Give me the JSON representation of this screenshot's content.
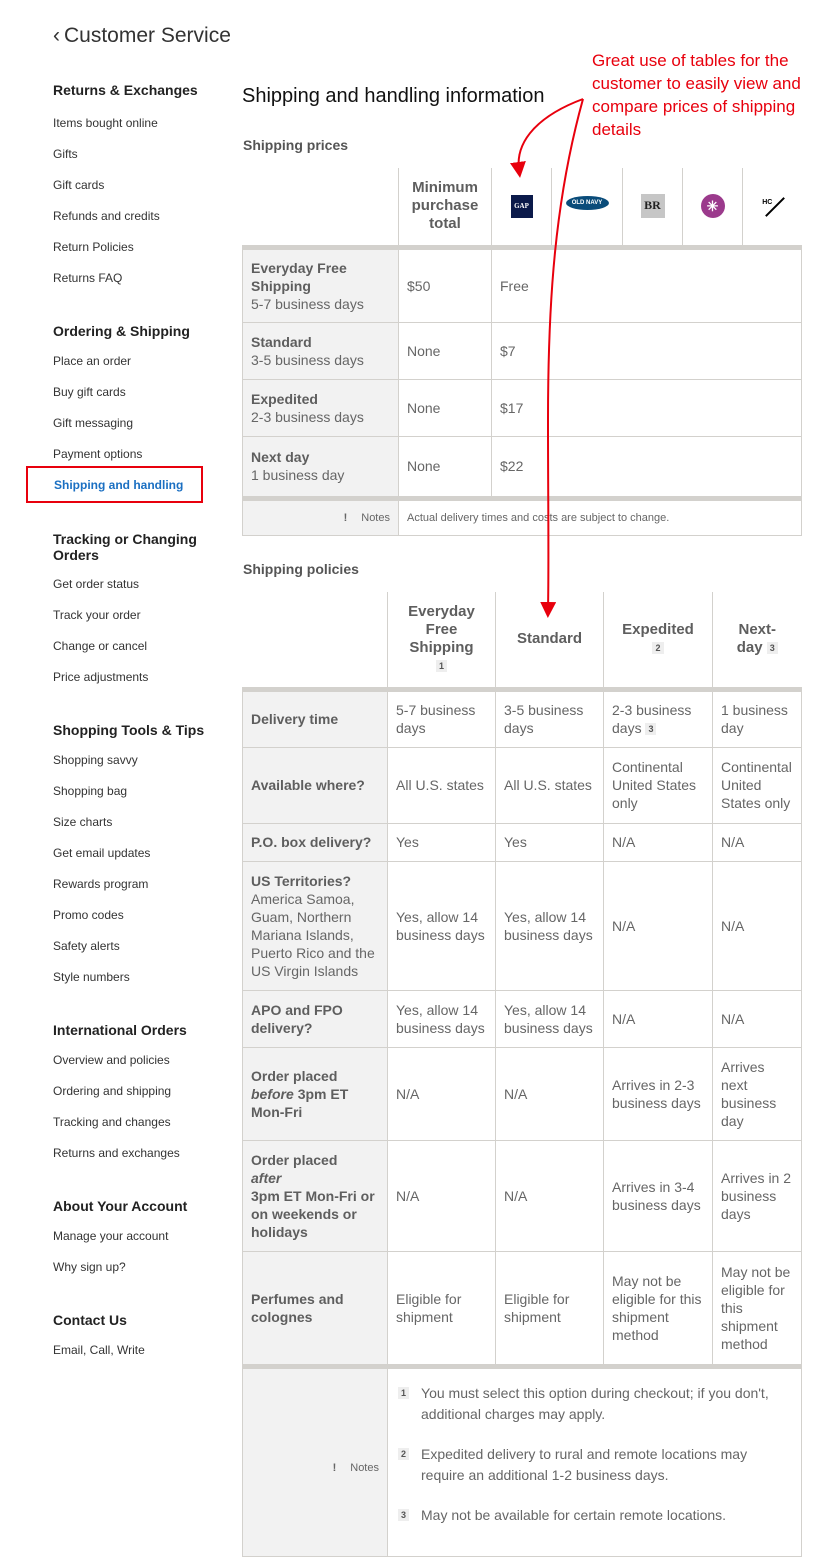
{
  "header": {
    "back_chevron": "‹",
    "back_label": "Customer Service"
  },
  "sidebar": {
    "groups": [
      {
        "heading": "Returns & Exchanges",
        "items": [
          "Items bought online",
          "Gifts",
          "Gift cards",
          "Refunds and credits",
          "Return Policies",
          "Returns FAQ"
        ]
      },
      {
        "heading": "Ordering & Shipping",
        "items": [
          "Place an order",
          "Buy gift cards",
          "Gift messaging",
          "Payment options",
          "Shipping and handling"
        ]
      },
      {
        "heading": "Tracking or Changing Orders",
        "items": [
          "Get order status",
          "Track your order",
          "Change or cancel",
          "Price adjustments"
        ]
      },
      {
        "heading": "Shopping Tools & Tips",
        "items": [
          "Shopping savvy",
          "Shopping bag",
          "Size charts",
          "Get email updates",
          "Rewards program",
          "Promo codes",
          "Safety alerts",
          "Style numbers"
        ]
      },
      {
        "heading": "International Orders",
        "items": [
          "Overview and policies",
          "Ordering and shipping",
          "Tracking and changes",
          "Returns and exchanges"
        ]
      },
      {
        "heading": "About Your Account",
        "items": [
          "Manage your account",
          "Why sign up?"
        ]
      },
      {
        "heading": "Contact Us",
        "items": [
          "Email, Call, Write"
        ]
      }
    ],
    "active_item": "Shipping and handling"
  },
  "main": {
    "title": "Shipping and handling information",
    "prices": {
      "section_title": "Shipping prices",
      "min_purchase_header": "Minimum purchase total",
      "brands": [
        {
          "name": "Gap",
          "text": "GAP",
          "icon": "gap-logo"
        },
        {
          "name": "Old Navy",
          "text": "OLD NAVY",
          "icon": "old-navy-logo"
        },
        {
          "name": "Banana Republic Factory",
          "text": "BR",
          "icon": "banana-republic-logo"
        },
        {
          "name": "Athleta",
          "text": "✳",
          "icon": "athleta-logo"
        },
        {
          "name": "Hill City",
          "text": "HC",
          "icon": "hill-city-logo"
        }
      ],
      "rows": [
        {
          "name": "Everyday Free Shipping",
          "days": "5-7 business days",
          "minimum": "$50",
          "price": "Free"
        },
        {
          "name": "Standard",
          "days": "3-5 business days",
          "minimum": "None",
          "price": "$7"
        },
        {
          "name": "Expedited",
          "days": "2-3 business days",
          "minimum": "None",
          "price": "$17"
        },
        {
          "name": "Next day",
          "days": "1 business day",
          "minimum": "None",
          "price": "$22"
        }
      ],
      "notes_icon": "!",
      "notes_label": "Notes",
      "notes_text": "Actual delivery times and costs are subject to change."
    },
    "policies": {
      "section_title": "Shipping policies",
      "columns": [
        {
          "label": "Everyday Free Shipping",
          "footnote": "1"
        },
        {
          "label": "Standard",
          "footnote": ""
        },
        {
          "label": "Expedited",
          "footnote": "2"
        },
        {
          "label": "Next-day",
          "footnote": "3"
        }
      ],
      "rows": [
        {
          "label": "Delivery time",
          "cells": [
            "5-7 business days",
            "3-5 business days",
            "2-3 business days",
            "1 business day"
          ],
          "cell_footnotes": [
            "",
            "",
            "3",
            ""
          ]
        },
        {
          "label": "Available where?",
          "cells": [
            "All U.S. states",
            "All U.S. states",
            "Continental United States only",
            "Continental United States only"
          ]
        },
        {
          "label": "P.O. box delivery?",
          "cells": [
            "Yes",
            "Yes",
            "N/A",
            "N/A"
          ]
        },
        {
          "label": "US Territories?",
          "sub": "America Samoa, Guam, Northern Mariana Islands, Puerto Rico and the US Virgin Islands",
          "cells": [
            "Yes, allow 14 business days",
            "Yes, allow 14 business days",
            "N/A",
            "N/A"
          ]
        },
        {
          "label": "APO and FPO delivery?",
          "cells": [
            "Yes, allow 14 business days",
            "Yes, allow 14 business days",
            "N/A",
            "N/A"
          ]
        },
        {
          "label_pre": "Order placed",
          "label_em": "before",
          "label_post": "3pm ET Mon-Fri",
          "cells": [
            "N/A",
            "N/A",
            "Arrives in 2-3 business days",
            "Arrives next business day"
          ]
        },
        {
          "label_pre": "Order placed",
          "label_em": "after",
          "label_post": "3pm ET Mon-Fri or on weekends or holidays",
          "cells": [
            "N/A",
            "N/A",
            "Arrives in 3-4 business days",
            "Arrives in 2 business days"
          ]
        },
        {
          "label": "Perfumes and colognes",
          "cells": [
            "Eligible for shipment",
            "Eligible for shipment",
            "May not be eligible for this shipment method",
            "May not be eligible for this shipment method"
          ]
        }
      ],
      "notes_icon": "!",
      "notes_label": "Notes",
      "notes": [
        {
          "num": "1",
          "text": "You must select this option during checkout; if you don't, additional charges may apply."
        },
        {
          "num": "2",
          "text": "Expedited delivery to rural and remote locations may require an additional 1-2 business days."
        },
        {
          "num": "3",
          "text": "May not be available for certain remote locations."
        }
      ]
    }
  },
  "annotation": {
    "text": "Great use of tables for the customer to easily view and compare prices of shipping details",
    "color": "#e8000d"
  },
  "colors": {
    "active_link": "#1a6fc2",
    "table_border": "#d3d1cd",
    "row_header_bg": "#f2f2f2"
  }
}
